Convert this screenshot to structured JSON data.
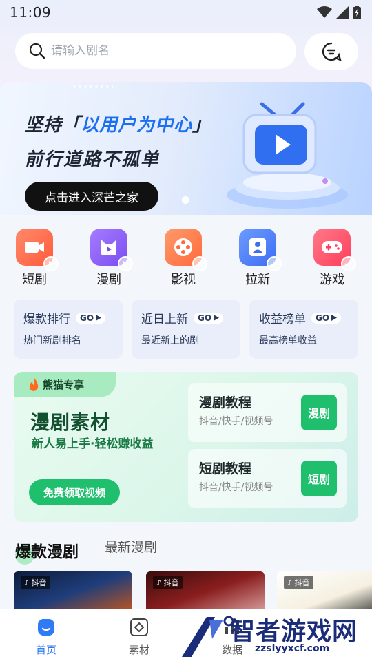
{
  "status": {
    "time": "11:09"
  },
  "search": {
    "placeholder": "请输入剧名"
  },
  "banner": {
    "line1_pre": "坚持「",
    "line1_highlight": "以用户为中心",
    "line1_post": "」",
    "line2": "前行道路不孤单",
    "button": "点击进入深芒之家"
  },
  "categories": [
    {
      "label": "短剧",
      "icon": "video-camera-icon",
      "color": "#ff6a4d"
    },
    {
      "label": "漫剧",
      "icon": "cat-tv-icon",
      "color": "#8b5cf6"
    },
    {
      "label": "影视",
      "icon": "film-reel-icon",
      "color": "#ff7a45"
    },
    {
      "label": "拉新",
      "icon": "user-add-icon",
      "color": "#4f7df7"
    },
    {
      "label": "游戏",
      "icon": "gamepad-icon",
      "color": "#ff4d6a"
    }
  ],
  "rankings": [
    {
      "title": "爆款排行",
      "go": "GO",
      "sub": "热门新剧排名"
    },
    {
      "title": "近日上新",
      "go": "GO",
      "sub": "最近新上的剧"
    },
    {
      "title": "收益榜单",
      "go": "GO",
      "sub": "最高榜单收益"
    }
  ],
  "promo": {
    "tag": "熊猫专享",
    "title": "漫剧素材",
    "subtitle": "新人易上手·轻松赚收益",
    "button": "免费领取视频",
    "tutorials": [
      {
        "title": "漫剧教程",
        "sub": "抖音/快手/视频号",
        "button": "漫剧"
      },
      {
        "title": "短剧教程",
        "sub": "抖音/快手/视频号",
        "button": "短剧"
      }
    ]
  },
  "tabs": {
    "active": "爆款漫剧",
    "inactive": "最新漫剧"
  },
  "thumbs": [
    {
      "badge": "抖音"
    },
    {
      "badge": "抖音"
    },
    {
      "badge": "抖音"
    }
  ],
  "nav": [
    {
      "label": "首页",
      "icon": "home-icon",
      "active": true
    },
    {
      "label": "素材",
      "icon": "material-icon",
      "active": false
    },
    {
      "label": "数据",
      "icon": "data-icon",
      "active": false
    }
  ],
  "watermark": {
    "text": "智者游戏网",
    "url": "zzslyyxcf.com"
  },
  "colors": {
    "accent": "#2f7af5",
    "green": "#1fbf6e"
  }
}
